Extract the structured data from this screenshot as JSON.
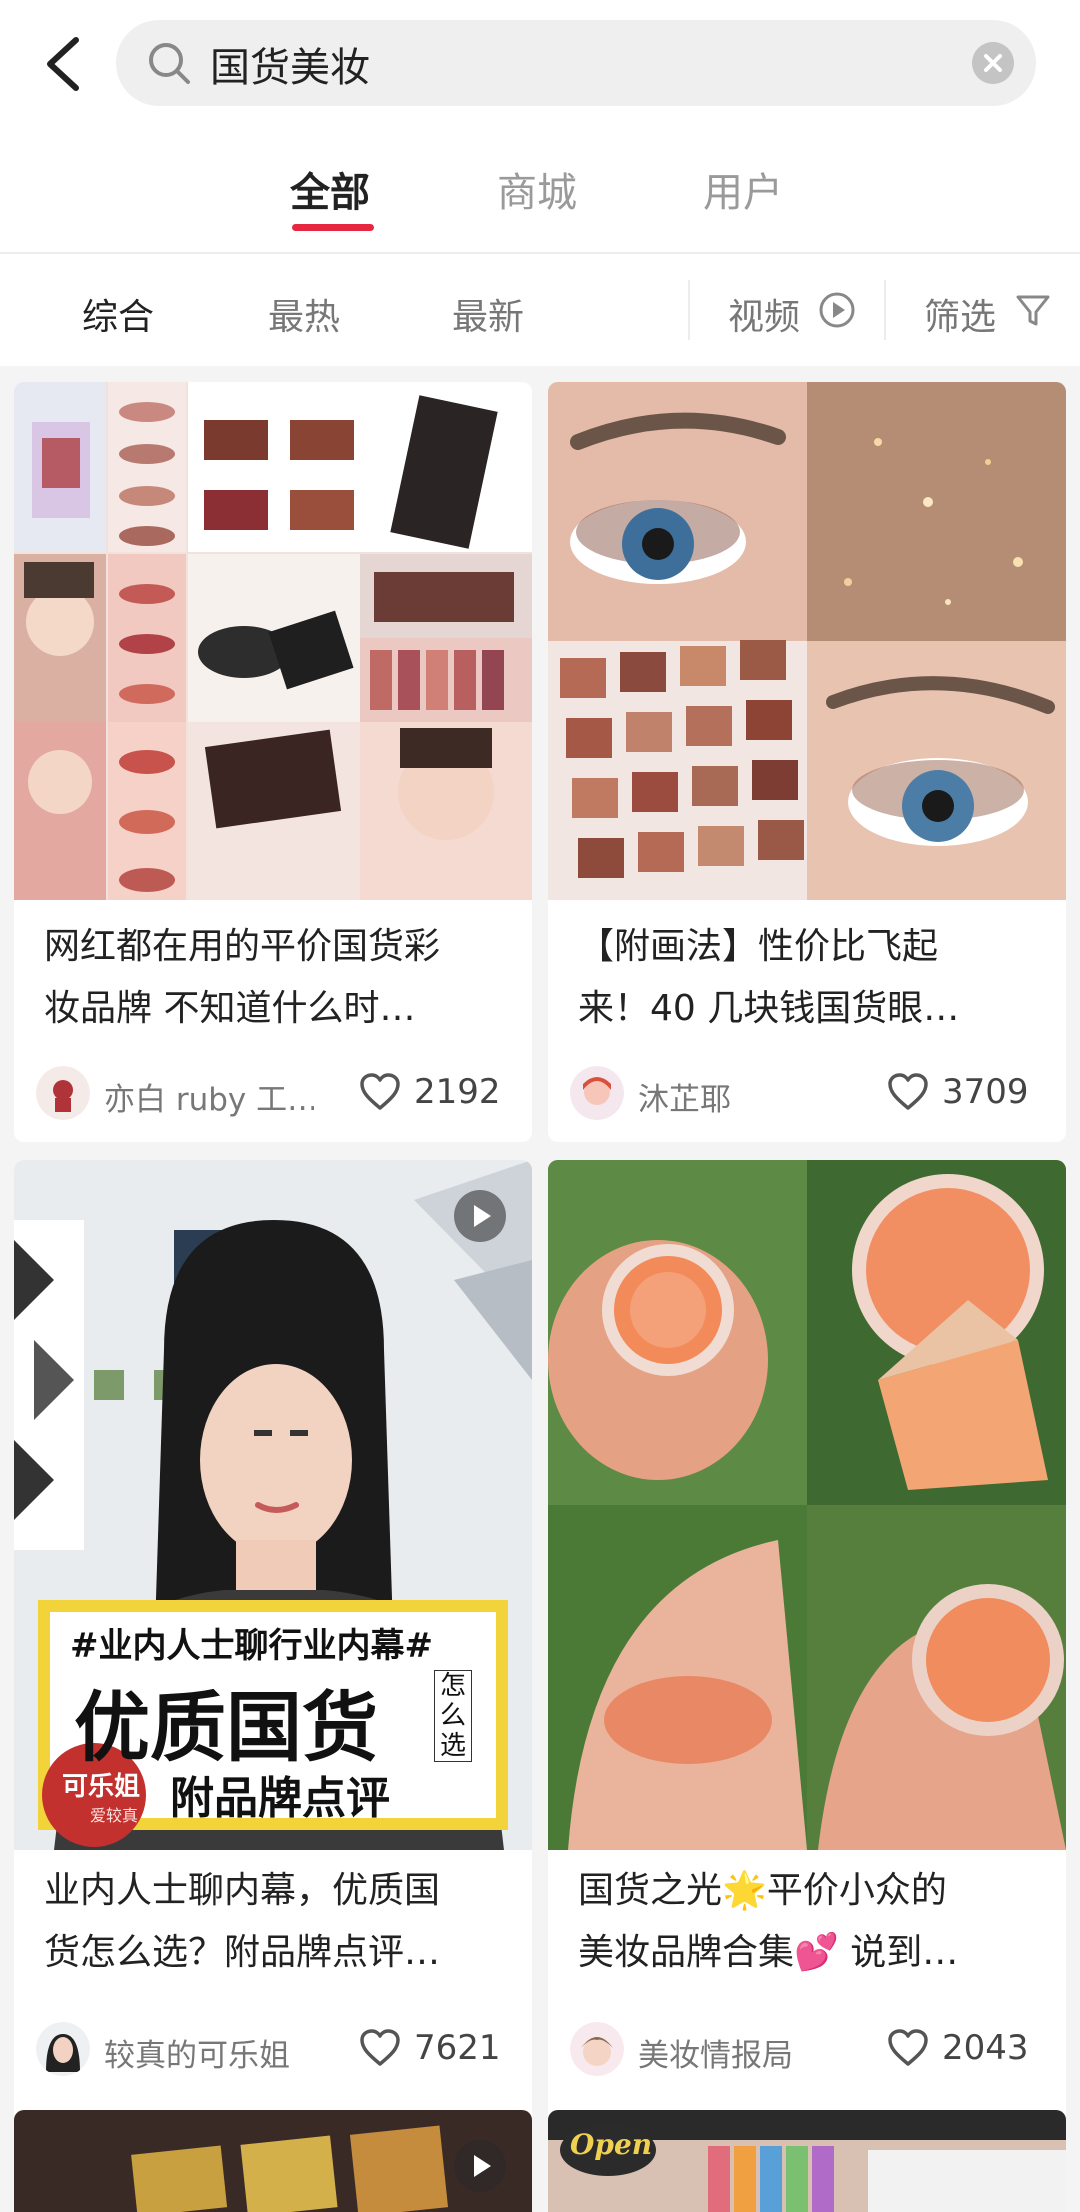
{
  "search": {
    "query": "国货美妆"
  },
  "tabs": [
    {
      "label": "全部",
      "active": true
    },
    {
      "label": "商城",
      "active": false
    },
    {
      "label": "用户",
      "active": false
    }
  ],
  "sort": {
    "items": [
      {
        "label": "综合",
        "active": true
      },
      {
        "label": "最热",
        "active": false
      },
      {
        "label": "最新",
        "active": false
      }
    ],
    "video_label": "视频",
    "filter_label": "筛选"
  },
  "colors": {
    "accent": "#e5283f",
    "search_bg": "#efefef",
    "feed_bg": "#f4f4f4"
  },
  "cards": [
    {
      "title": "网红都在用的平价国货彩\n妆品牌 不知道什么时…",
      "author": "亦白 ruby 工…",
      "likes": "2192",
      "is_video": false
    },
    {
      "title": "【附画法】性价比飞起\n来！40 几块钱国货眼…",
      "author": "沐芷耶",
      "likes": "3709",
      "is_video": false
    },
    {
      "title": "业内人士聊内幕，优质国\n货怎么选？附品牌点评…",
      "author": "较真的可乐姐",
      "likes": "7621",
      "is_video": true,
      "cover_text": {
        "tag": "#业内人士聊行业内幕#",
        "headline": "优质国货",
        "side": "怎么选",
        "sub": "附品牌点评",
        "badge": "可乐姐",
        "badge_sub": "爱较真"
      }
    },
    {
      "title": "国货之光🌟平价小众的\n美妆品牌合集💕 说到…",
      "author": "美妆情报局",
      "likes": "2043",
      "is_video": false
    },
    {
      "title": "",
      "author": "",
      "likes": "",
      "is_video": true
    },
    {
      "title": "",
      "author": "",
      "likes": "",
      "is_video": false,
      "cover_text": {
        "logo": "Open"
      }
    }
  ]
}
